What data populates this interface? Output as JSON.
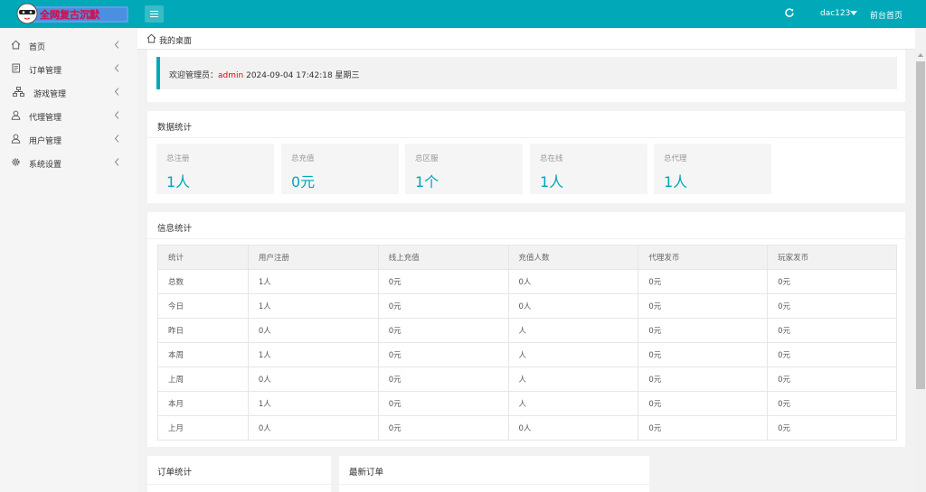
{
  "header": {
    "logo_text": "全网复古沉默",
    "user": "dac123",
    "front_home": "前台首页"
  },
  "sidebar": {
    "items": [
      {
        "label": "首页",
        "icon": "home-icon"
      },
      {
        "label": "订单管理",
        "icon": "document-icon"
      },
      {
        "label": "游戏管理",
        "icon": "sitemap-icon"
      },
      {
        "label": "代理管理",
        "icon": "user-icon"
      },
      {
        "label": "用户管理",
        "icon": "user-icon"
      },
      {
        "label": "系统设置",
        "icon": "gear-icon"
      }
    ]
  },
  "breadcrumb": {
    "label": "我的桌面"
  },
  "welcome": {
    "prefix": "欢迎管理员：",
    "admin": "admin",
    "datetime": "2024-09-04  17:42:18  星期三"
  },
  "data_stats": {
    "title": "数据统计",
    "cards": [
      {
        "label": "总注册",
        "value": "1人"
      },
      {
        "label": "总充值",
        "value": "0元"
      },
      {
        "label": "总区服",
        "value": "1个"
      },
      {
        "label": "总在线",
        "value": "1人"
      },
      {
        "label": "总代理",
        "value": "1人"
      }
    ]
  },
  "info_stats": {
    "title": "信息统计",
    "columns": [
      "统计",
      "用户注册",
      "线上充值",
      "充值人数",
      "代理发币",
      "玩家发币"
    ],
    "rows": [
      [
        "总数",
        "1人",
        "0元",
        "0人",
        "0元",
        "0元"
      ],
      [
        "今日",
        "1人",
        "0元",
        "0人",
        "0元",
        "0元"
      ],
      [
        "昨日",
        "0人",
        "0元",
        "人",
        "0元",
        "0元"
      ],
      [
        "本周",
        "1人",
        "0元",
        "人",
        "0元",
        "0元"
      ],
      [
        "上周",
        "0人",
        "0元",
        "人",
        "0元",
        "0元"
      ],
      [
        "本月",
        "1人",
        "0元",
        "人",
        "0元",
        "0元"
      ],
      [
        "上月",
        "0人",
        "0元",
        "0人",
        "0元",
        "0元"
      ]
    ]
  },
  "order_stats": {
    "title": "订单统计"
  },
  "latest_orders": {
    "title": "最新订单"
  },
  "colors": {
    "accent": "#00a8b8",
    "admin": "#e00000"
  }
}
